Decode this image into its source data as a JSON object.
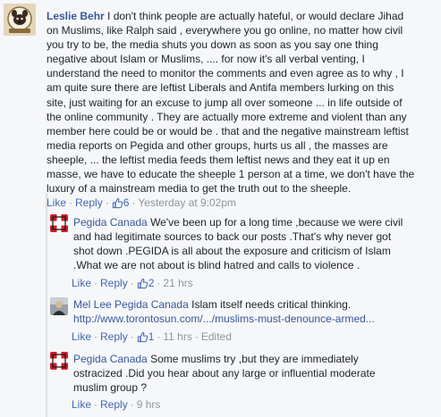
{
  "comments": [
    {
      "author": "Leslie Behr",
      "text": " I don't think people are actually hateful, or would declare Jihad\non Muslims, like Ralph said , everywhere you go online, no matter how civil\nyou try to be, the media shuts you down as soon as you say one thing\nnegative about Islam or Muslims, .... for now it's all verbal venting, I\nunderstand the need to monitor the comments and even agree as to why , I\nam quite sure there are leftist Liberals and Antifa members lurking on this\nsite, just waiting for an excuse to jump all over someone ... in life outside of\nthe online community . They are actually more extreme and violent than any\nmember here could be or would be . that and the negative mainstream leftist\nmedia reports on Pegida and other groups, hurts us all , the masses are\nsheeple, ... the leftist media feeds them leftist news and they eat it up en\nmasse, we have to educate the sheeple 1 person at a time, we don't have the\nluxury of a mainstream media to get the truth out to the sheeple.",
      "actions": {
        "like": "Like",
        "reply": "Reply",
        "like_count": "6",
        "time": "Yesterday at 9:02pm",
        "edited": ""
      }
    },
    {
      "author": "Pegida Canada",
      "text": " We've been up for a long time ,because we were civil\nand had legitimate sources to back our posts .That's why never got\nshot down .PEGIDA is all about the exposure and criticism of Islam\n.What we are not about is blind hatred and calls to violence .",
      "actions": {
        "like": "Like",
        "reply": "Reply",
        "like_count": "2",
        "time": "21 hrs",
        "edited": ""
      }
    },
    {
      "author": "Mel Lee",
      "author_extra": "Pegida Canada",
      "text": " Islam itself needs critical thinking.",
      "link": "http://www.torontosun.com/.../muslims-must-denounce-armed...",
      "actions": {
        "like": "Like",
        "reply": "Reply",
        "like_count": "1",
        "time": "11 hrs",
        "edited": "Edited"
      }
    },
    {
      "author": "Pegida Canada",
      "text": " Some muslims try ,but they are immediately\nostracized .Did you hear about any large or influential moderate\nmuslim group ?",
      "actions": {
        "like": "Like",
        "reply": "Reply",
        "like_count": "",
        "time": "9 hrs",
        "edited": ""
      }
    }
  ],
  "separator": "·",
  "colors": {
    "link": "#365899",
    "action": "#4267b2",
    "text": "#1d2129",
    "meta": "#90949c",
    "background": "#f6f7f9"
  },
  "avatars": [
    "dog-avatar-icon",
    "pegida-flag-avatar-icon",
    "person-avatar-icon",
    "pegida-flag-avatar-icon"
  ]
}
